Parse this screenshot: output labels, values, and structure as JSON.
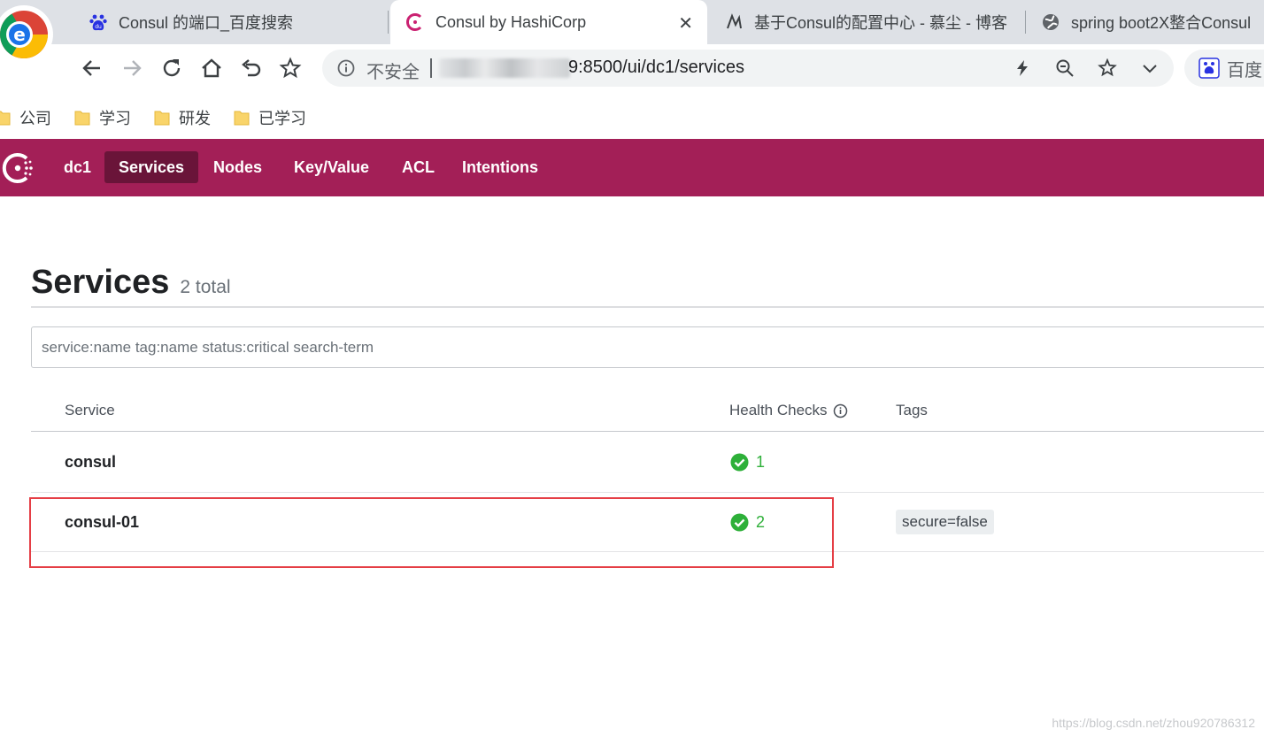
{
  "browser": {
    "tabs": [
      {
        "title": "Consul 的端口_百度搜索",
        "favicon": "baidu-paw-icon"
      },
      {
        "title": "Consul by HashiCorp",
        "favicon": "consul-icon",
        "active": true
      },
      {
        "title": "基于Consul的配置中心 - 慕尘 - 博客",
        "favicon": "blog-icon"
      },
      {
        "title": "spring boot2X整合Consul",
        "favicon": "globe-icon"
      }
    ],
    "close_glyph": "✕",
    "address": {
      "security_label": "不安全",
      "url_visible": "9:8500/ui/dc1/services"
    },
    "baidu_label": "百度",
    "bookmarks": [
      "公司",
      "学习",
      "研发",
      "已学习"
    ]
  },
  "consul": {
    "datacenter": "dc1",
    "nav": [
      {
        "label": "Services",
        "active": true
      },
      {
        "label": "Nodes"
      },
      {
        "label": "Key/Value"
      },
      {
        "label": "ACL"
      },
      {
        "label": "Intentions"
      }
    ],
    "page_title": "Services",
    "total_label": "2 total",
    "search_placeholder": "service:name tag:name status:critical search-term",
    "columns": {
      "service": "Service",
      "health": "Health Checks",
      "tags": "Tags"
    },
    "rows": [
      {
        "name": "consul",
        "health_passing": "1",
        "tags": []
      },
      {
        "name": "consul-01",
        "health_passing": "2",
        "tags": [
          "secure=false"
        ]
      }
    ]
  },
  "watermark": "https://blog.csdn.net/zhou920786312",
  "colors": {
    "brand": "#a31f57",
    "brand_active": "#6a1439",
    "passing": "#2eb039",
    "highlight": "#e53e45"
  }
}
